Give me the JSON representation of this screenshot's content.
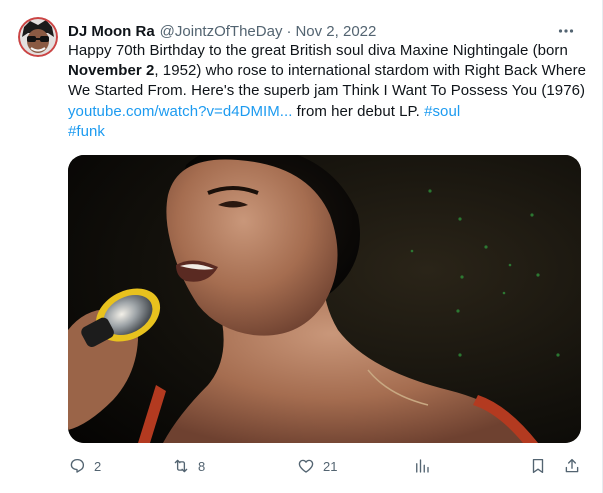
{
  "author": {
    "display_name": "DJ Moon Ra",
    "handle": "@JointzOfTheDay",
    "separator": "·",
    "date": "Nov 2, 2022",
    "avatar_icon": "avatar-icon"
  },
  "tweet": {
    "text_1": "Happy 70th Birthday to the great British soul diva Maxine Nightingale (born ",
    "bold_text": "November 2",
    "text_2": ", 1952) who rose to international stardom with Right Back Where We Started From. Here's the superb jam Think I Want To Possess You (1976) ",
    "link_text": "youtube.com/watch?v=d4DMIM...",
    "text_3": " from her debut LP. ",
    "hashtag_1": "#soul",
    "hashtag_2": "#funk"
  },
  "media": {
    "type": "video-still",
    "icon": "singer-photo"
  },
  "actions": {
    "reply_count": "2",
    "retweet_count": "8",
    "like_count": "21",
    "views_count": "",
    "icons": [
      "reply-icon",
      "retweet-icon",
      "like-icon",
      "views-icon",
      "bookmark-icon",
      "share-icon"
    ]
  },
  "colors": {
    "link": "#1d9bf0",
    "secondary_text": "#536471",
    "primary_text": "#0f1419"
  }
}
